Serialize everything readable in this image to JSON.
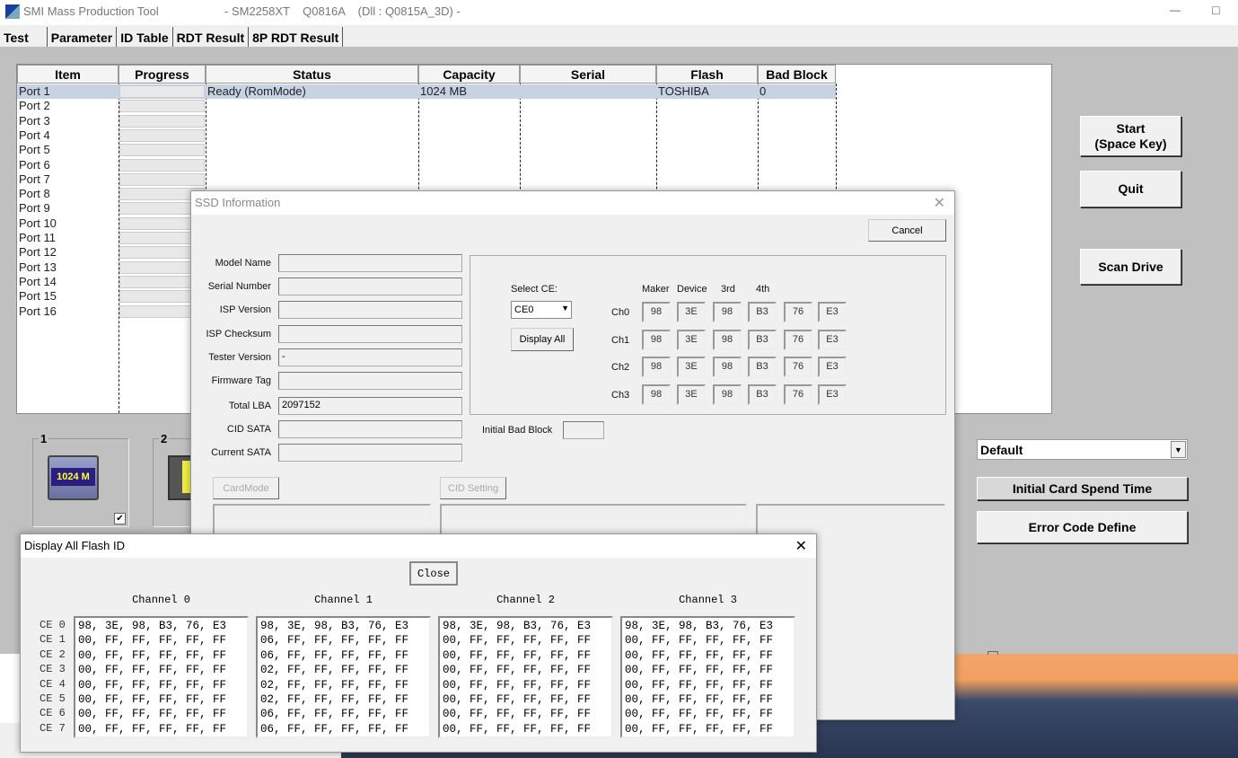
{
  "window": {
    "title": "SMI Mass Production Tool",
    "subtitle": "- SM2258XT    Q0816A    (Dll : Q0815A_3D) -",
    "minimize": "—",
    "maximize": "□"
  },
  "tabs": [
    "Test",
    "Parameter",
    "ID Table",
    "RDT Result",
    "8P RDT Result"
  ],
  "table": {
    "columns": [
      "Item",
      "Progress",
      "Status",
      "Capacity",
      "Serial",
      "Flash",
      "Bad Block"
    ],
    "rows": [
      {
        "item": "Port 1",
        "status": "Ready (RomMode)",
        "capacity": "1024 MB",
        "serial": "",
        "flash": "TOSHIBA",
        "bad_block": "0"
      },
      {
        "item": "Port 2"
      },
      {
        "item": "Port 3"
      },
      {
        "item": "Port 4"
      },
      {
        "item": "Port 5"
      },
      {
        "item": "Port 6"
      },
      {
        "item": "Port 7"
      },
      {
        "item": "Port 8"
      },
      {
        "item": "Port 9"
      },
      {
        "item": "Port 10"
      },
      {
        "item": "Port 11"
      },
      {
        "item": "Port 12"
      },
      {
        "item": "Port 13"
      },
      {
        "item": "Port 14"
      },
      {
        "item": "Port 15"
      },
      {
        "item": "Port 16"
      }
    ],
    "selected_row_color": "#c7d3e3"
  },
  "buttons": {
    "start": "Start\n(Space Key)",
    "quit": "Quit",
    "scan": "Scan Drive",
    "initial_card": "Initial Card Spend Time",
    "error_code": "Error Code Define"
  },
  "profile_select": {
    "value": "Default"
  },
  "ports": [
    {
      "label": "1",
      "capacity": "1024 M",
      "checked": true
    },
    {
      "label": "2"
    }
  ],
  "ssd_info": {
    "title": "SSD Information",
    "cancel": "Cancel",
    "fields": [
      {
        "label": "Model Name",
        "value": ""
      },
      {
        "label": "Serial Number",
        "value": ""
      },
      {
        "label": "ISP Version",
        "value": ""
      },
      {
        "label": "ISP Checksum",
        "value": ""
      },
      {
        "label": "Tester Version",
        "value": "-"
      },
      {
        "label": "Firmware Tag",
        "value": ""
      },
      {
        "label": "Total LBA",
        "value": "2097152"
      },
      {
        "label": "CID SATA",
        "value": ""
      },
      {
        "label": "Current SATA",
        "value": ""
      }
    ],
    "select_ce_label": "Select CE:",
    "select_ce_value": "CE0",
    "display_all": "Display All",
    "id_headers": [
      "Maker",
      "Device",
      "3rd",
      "4th"
    ],
    "channels": [
      {
        "label": "Ch0",
        "ids": [
          "98",
          "3E",
          "98",
          "B3",
          "76",
          "E3"
        ]
      },
      {
        "label": "Ch1",
        "ids": [
          "98",
          "3E",
          "98",
          "B3",
          "76",
          "E3"
        ]
      },
      {
        "label": "Ch2",
        "ids": [
          "98",
          "3E",
          "98",
          "B3",
          "76",
          "E3"
        ]
      },
      {
        "label": "Ch3",
        "ids": [
          "98",
          "3E",
          "98",
          "B3",
          "76",
          "E3"
        ]
      }
    ],
    "initial_bad_block_label": "Initial Bad Block",
    "initial_bad_block": "",
    "card_mode": "CardMode",
    "cid_setting": "CID Setting"
  },
  "flash_id": {
    "title": "Display All Flash ID",
    "close": "Close",
    "ce_labels": [
      "CE 0",
      "CE 1",
      "CE 2",
      "CE 3",
      "CE 4",
      "CE 5",
      "CE 6",
      "CE 7"
    ],
    "channels": [
      {
        "label": "Channel 0",
        "rows": [
          "98, 3E, 98, B3, 76, E3",
          "00, FF, FF, FF, FF, FF",
          "00, FF, FF, FF, FF, FF",
          "00, FF, FF, FF, FF, FF",
          "00, FF, FF, FF, FF, FF",
          "00, FF, FF, FF, FF, FF",
          "00, FF, FF, FF, FF, FF",
          "00, FF, FF, FF, FF, FF"
        ]
      },
      {
        "label": "Channel 1",
        "rows": [
          "98, 3E, 98, B3, 76, E3",
          "06, FF, FF, FF, FF, FF",
          "06, FF, FF, FF, FF, FF",
          "02, FF, FF, FF, FF, FF",
          "02, FF, FF, FF, FF, FF",
          "02, FF, FF, FF, FF, FF",
          "06, FF, FF, FF, FF, FF",
          "06, FF, FF, FF, FF, FF"
        ]
      },
      {
        "label": "Channel 2",
        "rows": [
          "98, 3E, 98, B3, 76, E3",
          "00, FF, FF, FF, FF, FF",
          "00, FF, FF, FF, FF, FF",
          "00, FF, FF, FF, FF, FF",
          "00, FF, FF, FF, FF, FF",
          "00, FF, FF, FF, FF, FF",
          "00, FF, FF, FF, FF, FF",
          "00, FF, FF, FF, FF, FF"
        ]
      },
      {
        "label": "Channel 3",
        "rows": [
          "98, 3E, 98, B3, 76, E3",
          "00, FF, FF, FF, FF, FF",
          "00, FF, FF, FF, FF, FF",
          "00, FF, FF, FF, FF, FF",
          "00, FF, FF, FF, FF, FF",
          "00, FF, FF, FF, FF, FF",
          "00, FF, FF, FF, FF, FF",
          "00, FF, FF, FF, FF, FF"
        ]
      }
    ]
  }
}
